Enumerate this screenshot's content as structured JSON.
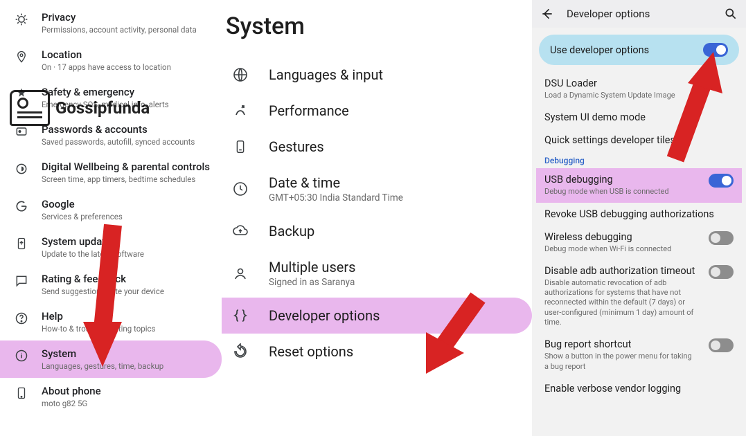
{
  "watermark": {
    "text": "Gossipfunda"
  },
  "pane1": {
    "items": [
      {
        "title": "Privacy",
        "sub": "Permissions, account activity, personal data"
      },
      {
        "title": "Location",
        "sub": "On · 17 apps have access to location"
      },
      {
        "title": "Safety & emergency",
        "sub": "Emergency SOS, medical info, alerts"
      },
      {
        "title": "Passwords & accounts",
        "sub": "Saved passwords, autofill, synced accounts"
      },
      {
        "title": "Digital Wellbeing & parental controls",
        "sub": "Screen time, app timers, bedtime schedules"
      },
      {
        "title": "Google",
        "sub": "Services & preferences"
      },
      {
        "title": "System update",
        "sub": "Update to the latest software"
      },
      {
        "title": "Rating & feedback",
        "sub": "Send suggestions, rate your device"
      },
      {
        "title": "Help",
        "sub": "How-to & troubleshooting topics"
      },
      {
        "title": "System",
        "sub": "Languages, gestures, time, backup"
      },
      {
        "title": "About phone",
        "sub": "moto g82 5G"
      }
    ]
  },
  "pane2": {
    "header": "System",
    "items": [
      {
        "title": "Languages & input",
        "sub": ""
      },
      {
        "title": "Performance",
        "sub": ""
      },
      {
        "title": "Gestures",
        "sub": ""
      },
      {
        "title": "Date & time",
        "sub": "GMT+05:30 India Standard Time"
      },
      {
        "title": "Backup",
        "sub": ""
      },
      {
        "title": "Multiple users",
        "sub": "Signed in as Saranya"
      },
      {
        "title": "Developer options",
        "sub": ""
      },
      {
        "title": "Reset options",
        "sub": ""
      }
    ]
  },
  "pane3": {
    "appbar_title": "Developer options",
    "master": {
      "label": "Use developer options"
    },
    "items_top": [
      {
        "title": "DSU Loader",
        "sub": "Load a Dynamic System Update Image"
      },
      {
        "title": "System UI demo mode",
        "sub": ""
      },
      {
        "title": "Quick settings developer tiles",
        "sub": ""
      }
    ],
    "section": "Debugging",
    "items_debug": [
      {
        "title": "USB debugging",
        "sub": "Debug mode when USB is connected",
        "toggle": "on"
      },
      {
        "title": "Revoke USB debugging authorizations",
        "sub": "",
        "toggle": ""
      },
      {
        "title": "Wireless debugging",
        "sub": "Debug mode when Wi-Fi is connected",
        "toggle": "off"
      },
      {
        "title": "Disable adb authorization timeout",
        "sub": "Disable automatic revocation of adb authorizations for systems that have not reconnected within the default (7 days) or user-configured (minimum 1 day) amount of time.",
        "toggle": "off"
      },
      {
        "title": "Bug report shortcut",
        "sub": "Show a button in the power menu for taking a bug report",
        "toggle": "off"
      },
      {
        "title": "Enable verbose vendor logging",
        "sub": "",
        "toggle": ""
      }
    ]
  }
}
